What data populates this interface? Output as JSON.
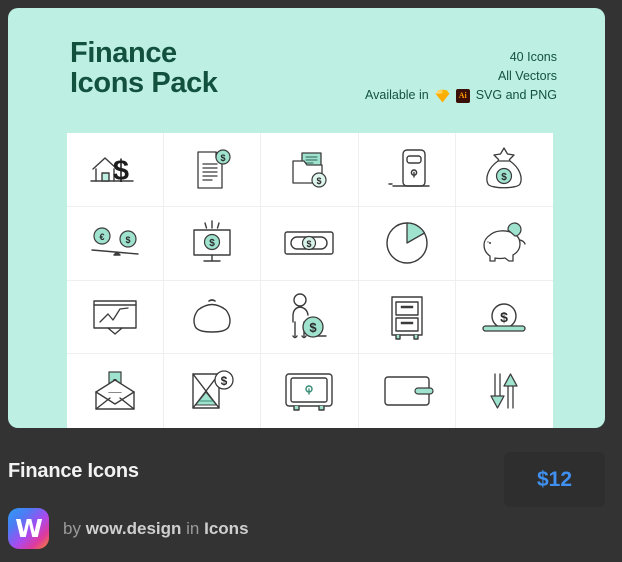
{
  "card": {
    "title": "Finance\nIcons Pack",
    "meta": {
      "count": "40 Icons",
      "vectors": "All Vectors",
      "available_prefix": "Available in",
      "available_formats": "SVG and PNG",
      "format_icons": [
        "sketch-icon",
        "illustrator-icon"
      ]
    },
    "background_color": "#bdf0e3",
    "title_color": "#13513f",
    "accent_color": "#8fe0cc"
  },
  "grid": {
    "rows": 4,
    "columns": 5,
    "icons": [
      {
        "name": "house-dollar-icon",
        "label": "House with dollar sign"
      },
      {
        "name": "document-dollar-icon",
        "label": "Document with dollar badge"
      },
      {
        "name": "folder-dollar-icon",
        "label": "Folder with dollar coin"
      },
      {
        "name": "atm-machine-icon",
        "label": "ATM machine"
      },
      {
        "name": "money-bag-icon",
        "label": "Money bag with dollar"
      },
      {
        "name": "currency-balance-icon",
        "label": "Euro dollar balance scale"
      },
      {
        "name": "monitor-dollar-icon",
        "label": "Monitor with dollar coin"
      },
      {
        "name": "banknote-icon",
        "label": "Banknote with dollar"
      },
      {
        "name": "pie-chart-icon",
        "label": "Pie chart"
      },
      {
        "name": "piggy-bank-icon",
        "label": "Piggy bank"
      },
      {
        "name": "presentation-chart-icon",
        "label": "Presentation board with line chart"
      },
      {
        "name": "coin-purse-icon",
        "label": "Coin purse"
      },
      {
        "name": "person-coin-icon",
        "label": "Person with dollar coin"
      },
      {
        "name": "filing-cabinet-icon",
        "label": "Filing cabinet"
      },
      {
        "name": "coin-platform-icon",
        "label": "Coin on platform"
      },
      {
        "name": "envelope-money-icon",
        "label": "Envelope with money"
      },
      {
        "name": "hourglass-dollar-icon",
        "label": "Hourglass with dollar coin"
      },
      {
        "name": "safe-vault-icon",
        "label": "Safe vault"
      },
      {
        "name": "wallet-card-icon",
        "label": "Wallet with card"
      },
      {
        "name": "transfer-arrows-icon",
        "label": "Up and down transfer arrows"
      }
    ]
  },
  "info": {
    "item_title": "Finance Icons",
    "price": "$12",
    "price_color": "#3f90f0",
    "author_prefix": "by",
    "author_name": "wow.design",
    "category_prefix": "in",
    "category": "Icons",
    "logo_letter": "W"
  }
}
